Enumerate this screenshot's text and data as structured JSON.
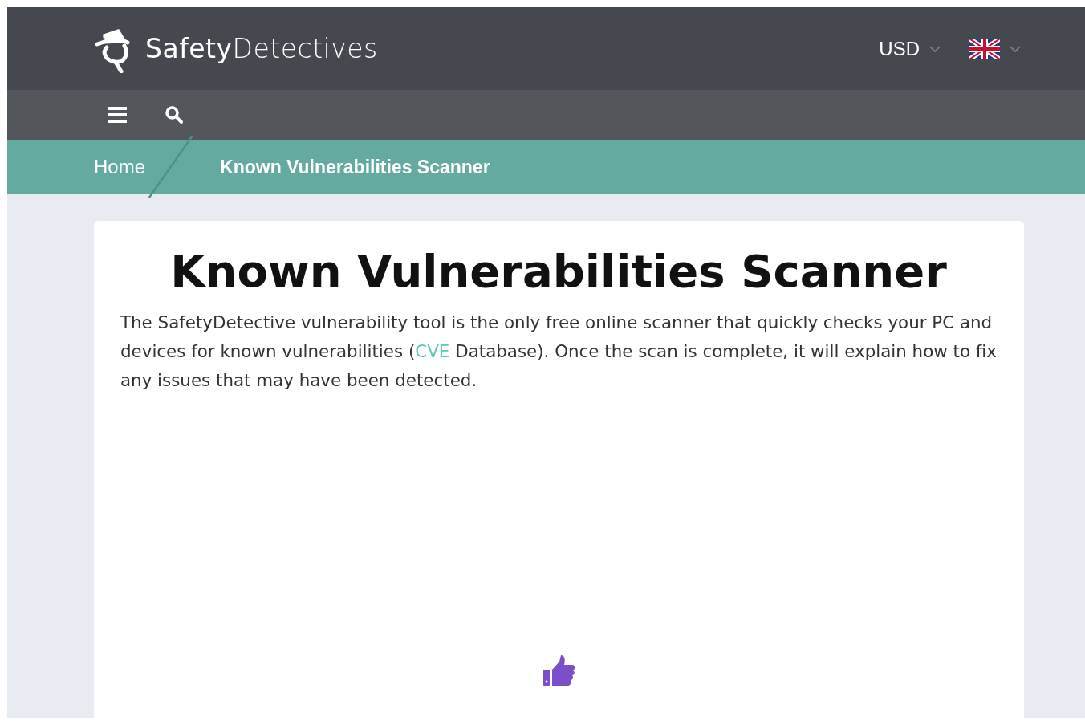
{
  "header": {
    "logo": "**Safety**Detectives",
    "currency": "USD"
  },
  "breadcrumb": [
    {
      "label": "Home",
      "current": false
    },
    {
      "label": "Known Vulnerabilities Scanner",
      "current": true
    }
  ],
  "card": {
    "title": "Known Vulnerabilities Scanner",
    "intro": {
      "before": "The SafetyDetective vulnerability tool is the only free online scanner that quickly checks your PC and devices for known vulnerabilities (",
      "link": "CVE",
      "after": " Database). Once the scan is complete, it will explain how to fix any issues that may have been detected."
    }
  }
}
